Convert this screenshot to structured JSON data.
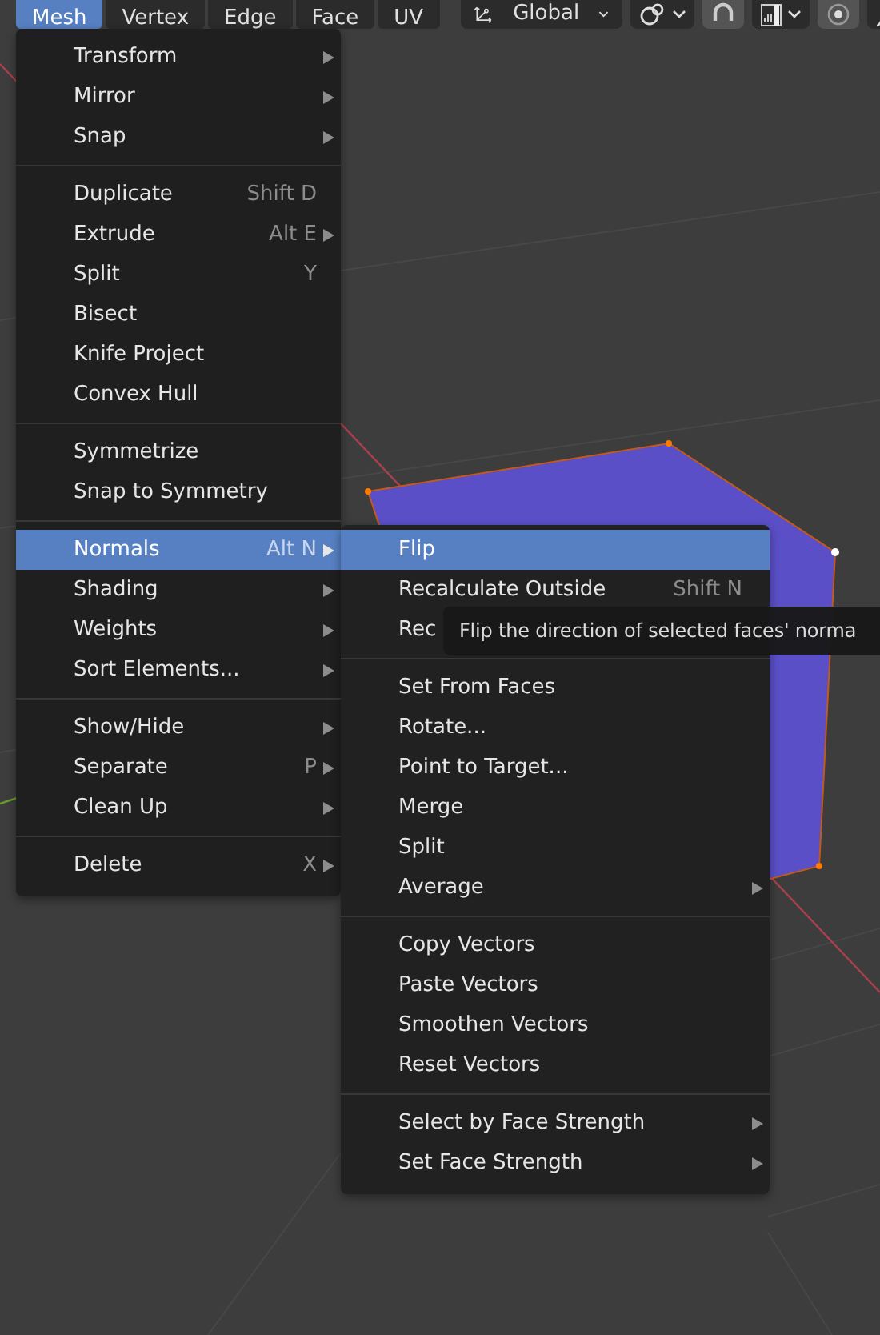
{
  "header": {
    "menus": [
      {
        "label": "Mesh",
        "selected": true
      },
      {
        "label": "Vertex",
        "selected": false
      },
      {
        "label": "Edge",
        "selected": false
      },
      {
        "label": "Face",
        "selected": false
      },
      {
        "label": "UV",
        "selected": false
      }
    ],
    "orientation": {
      "label": "Global"
    }
  },
  "mesh_menu": {
    "sections": [
      {
        "items": [
          {
            "label": "Transform",
            "has_submenu": true,
            "selected": false
          },
          {
            "label": "Mirror",
            "has_submenu": true,
            "selected": false
          },
          {
            "label": "Snap",
            "has_submenu": true,
            "selected": false
          }
        ]
      },
      {
        "items": [
          {
            "label": "Duplicate",
            "shortcut": "Shift D",
            "has_submenu": false,
            "selected": false
          },
          {
            "label": "Extrude",
            "shortcut": "Alt E",
            "has_submenu": true,
            "selected": false
          },
          {
            "label": "Split",
            "shortcut": "Y",
            "has_submenu": false,
            "selected": false
          },
          {
            "label": "Bisect",
            "has_submenu": false,
            "selected": false
          },
          {
            "label": "Knife Project",
            "has_submenu": false,
            "selected": false
          },
          {
            "label": "Convex Hull",
            "has_submenu": false,
            "selected": false
          }
        ]
      },
      {
        "items": [
          {
            "label": "Symmetrize",
            "has_submenu": false,
            "selected": false
          },
          {
            "label": "Snap to Symmetry",
            "has_submenu": false,
            "selected": false
          }
        ]
      },
      {
        "items": [
          {
            "label": "Normals",
            "shortcut": "Alt N",
            "has_submenu": true,
            "selected": true
          },
          {
            "label": "Shading",
            "has_submenu": true,
            "selected": false
          },
          {
            "label": "Weights",
            "has_submenu": true,
            "selected": false
          },
          {
            "label": "Sort Elements...",
            "has_submenu": true,
            "selected": false
          }
        ]
      },
      {
        "items": [
          {
            "label": "Show/Hide",
            "has_submenu": true,
            "selected": false
          },
          {
            "label": "Separate",
            "shortcut": "P",
            "has_submenu": true,
            "selected": false
          },
          {
            "label": "Clean Up",
            "has_submenu": true,
            "selected": false
          }
        ]
      },
      {
        "items": [
          {
            "label": "Delete",
            "shortcut": "X",
            "has_submenu": true,
            "selected": false
          }
        ]
      }
    ]
  },
  "normals_menu": {
    "sections": [
      {
        "items": [
          {
            "label": "Flip",
            "has_submenu": false,
            "selected": true
          },
          {
            "label": "Recalculate Outside",
            "shortcut": "Shift N",
            "has_submenu": false,
            "selected": false
          },
          {
            "label": "Rec",
            "has_submenu": false,
            "selected": false
          }
        ]
      },
      {
        "items": [
          {
            "label": "Set From Faces",
            "has_submenu": false,
            "selected": false
          },
          {
            "label": "Rotate...",
            "has_submenu": false,
            "selected": false
          },
          {
            "label": "Point to Target...",
            "has_submenu": false,
            "selected": false
          },
          {
            "label": "Merge",
            "has_submenu": false,
            "selected": false
          },
          {
            "label": "Split",
            "has_submenu": false,
            "selected": false
          },
          {
            "label": "Average",
            "has_submenu": true,
            "selected": false
          }
        ]
      },
      {
        "items": [
          {
            "label": "Copy Vectors",
            "has_submenu": false,
            "selected": false
          },
          {
            "label": "Paste Vectors",
            "has_submenu": false,
            "selected": false
          },
          {
            "label": "Smoothen Vectors",
            "has_submenu": false,
            "selected": false
          },
          {
            "label": "Reset Vectors",
            "has_submenu": false,
            "selected": false
          }
        ]
      },
      {
        "items": [
          {
            "label": "Select by Face Strength",
            "has_submenu": true,
            "selected": false
          },
          {
            "label": "Set Face Strength",
            "has_submenu": true,
            "selected": false
          }
        ]
      }
    ]
  },
  "tooltip": {
    "text": "Flip the direction of selected faces' norma"
  }
}
